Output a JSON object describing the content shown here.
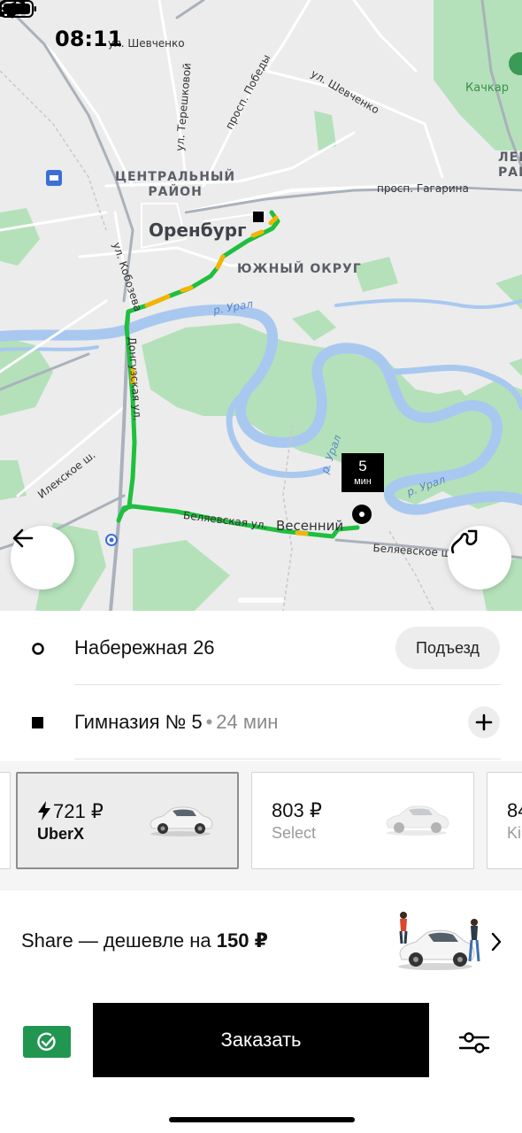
{
  "status_bar": {
    "time": "08:11"
  },
  "map": {
    "city": "Оренбург",
    "districts": [
      "ЦЕНТРАЛЬНЫЙ\nРАЙОН",
      "ЮЖНЫЙ ОКРУГ",
      "ЛЕНИН\nРАЙ"
    ],
    "streets": {
      "shevchenko_top": "ул. Шевченко",
      "shevchenko": "ул. Шевченко",
      "pobedy": "просп. Победы",
      "tereshkovoy": "ул. Терешковой",
      "gagarina": "просп. Гагарина",
      "kobozeva": "ул. Кобозева",
      "donguzskaya": "Донгузская ул.",
      "ileckoe": "Илекское ш.",
      "belyaevskaya": "Беляевская ул.",
      "belyaevskoe": "Беляевское ш."
    },
    "rivers": [
      "р. Урал",
      "р. Урал",
      "р. Урал"
    ],
    "places": {
      "vesenniy": "Весенний",
      "kachkar": "Качкар"
    },
    "eta": {
      "value": "5",
      "unit": "мин"
    }
  },
  "route": {
    "pickup": {
      "address": "Набережная 26",
      "entrance_label": "Подъезд"
    },
    "destination": {
      "address": "Гимназия № 5",
      "separator": "•",
      "duration": "24 мин"
    }
  },
  "tariffs": [
    {
      "price": "721 ₽",
      "name": "UberX",
      "selected": true,
      "surge": true
    },
    {
      "price": "803 ₽",
      "name": "Select",
      "selected": false
    },
    {
      "price": "84",
      "name": "Ki",
      "selected": false
    }
  ],
  "share": {
    "text_prefix": "Share — дешевле на ",
    "amount": "150 ₽"
  },
  "order": {
    "button_label": "Заказать"
  },
  "colors": {
    "route_green": "#1fbf3f",
    "route_yellow": "#f5b400",
    "payment_green": "#219651",
    "water": "#a9c8f0",
    "park": "#a9dcb0"
  }
}
